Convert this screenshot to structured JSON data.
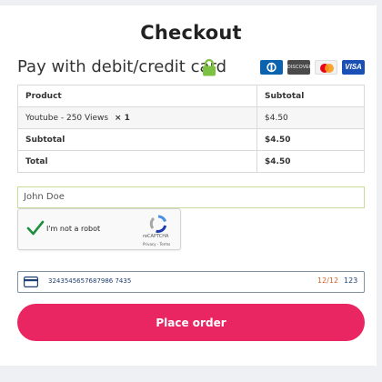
{
  "header": {
    "title": "Checkout"
  },
  "payment": {
    "heading": "Pay with debit/credit card",
    "card_brands": [
      "diners-club",
      "discover",
      "mastercard",
      "visa"
    ],
    "visa_text": "VISA",
    "discover_text": "DISCOVER"
  },
  "order_table": {
    "headers": [
      "Product",
      "Subtotal"
    ],
    "item": {
      "name": "Youtube - 250 Views",
      "qty": "× 1",
      "price": "$4.50"
    },
    "subtotal": {
      "label": "Subtotal",
      "value": "$4.50"
    },
    "total": {
      "label": "Total",
      "value": "$4.50"
    }
  },
  "form": {
    "name_value": "John Doe",
    "recaptcha": {
      "label": "I'm not a robot",
      "brand": "reCAPTCHA",
      "links": "Privacy - Terms",
      "checked": true
    },
    "card": {
      "number": "3243545657687986 7435",
      "expiry": "12/12",
      "cvc": "123"
    }
  },
  "actions": {
    "place_order": "Place order"
  },
  "colors": {
    "accent": "#e92662",
    "lock": "#7cc142",
    "check": "#1e8e3e"
  }
}
